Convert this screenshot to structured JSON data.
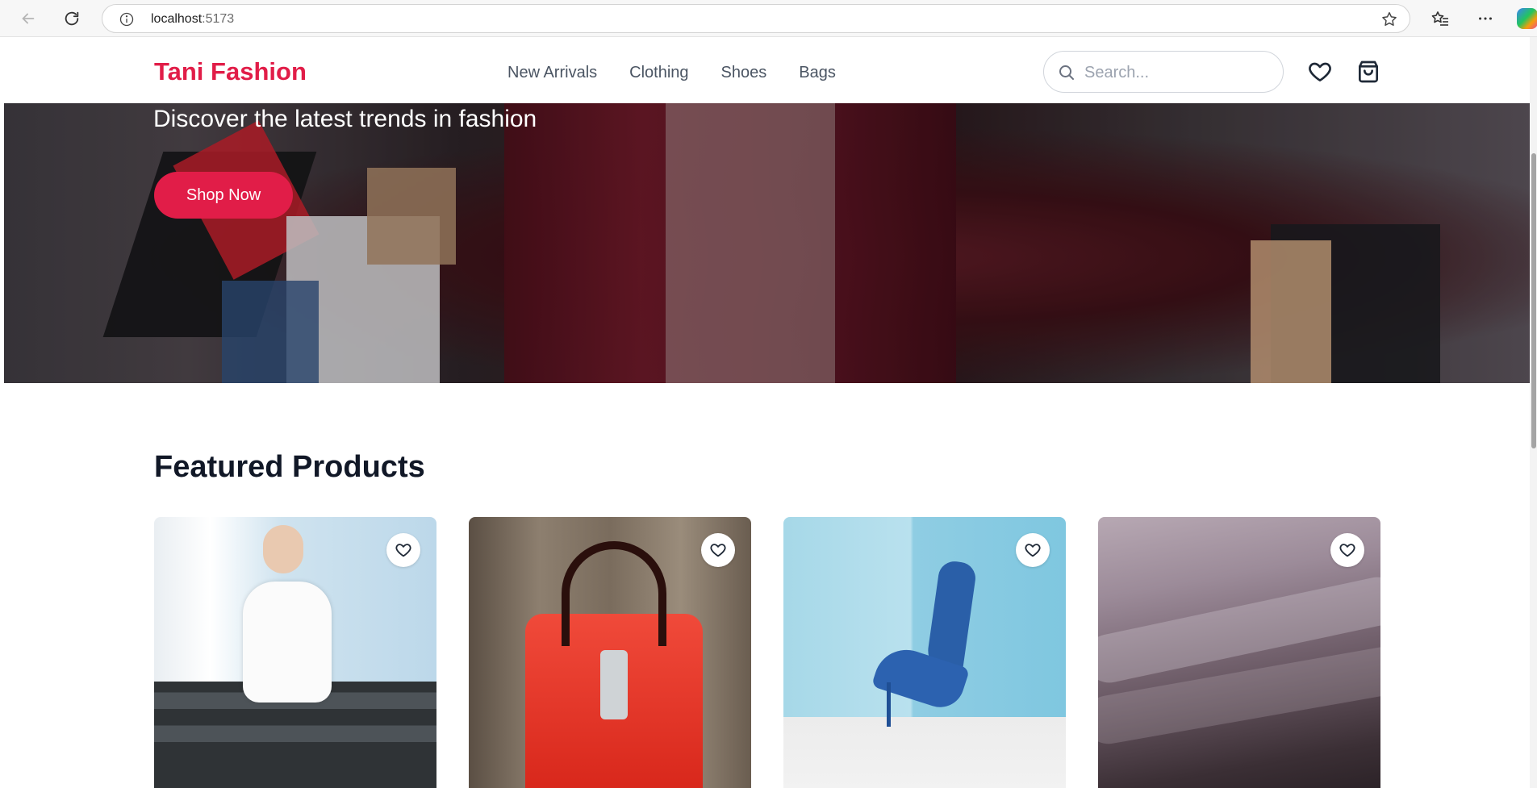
{
  "browser": {
    "url_host": "localhost",
    "url_port": ":5173"
  },
  "site": {
    "logo": "Tani Fashion",
    "nav": [
      "New Arrivals",
      "Clothing",
      "Shoes",
      "Bags"
    ],
    "search_placeholder": "Search...",
    "accent_color": "#e11d48"
  },
  "hero": {
    "subtitle": "Discover the latest trends in fashion",
    "cta_label": "Shop Now"
  },
  "featured": {
    "title": "Featured Products",
    "products": [
      {
        "image": "woman in white off-shoulder dress on stairs"
      },
      {
        "image": "red leather handbag"
      },
      {
        "image": "floral blue high heels"
      },
      {
        "image": "misty mountain landscape"
      }
    ]
  },
  "icons": {
    "back": "arrow-left-icon",
    "refresh": "refresh-icon",
    "info": "info-icon",
    "favorite_star": "star-icon",
    "favorites_list": "favorites-list-icon",
    "more": "more-icon",
    "search": "search-icon",
    "wishlist": "heart-icon",
    "cart": "shopping-bag-icon"
  }
}
